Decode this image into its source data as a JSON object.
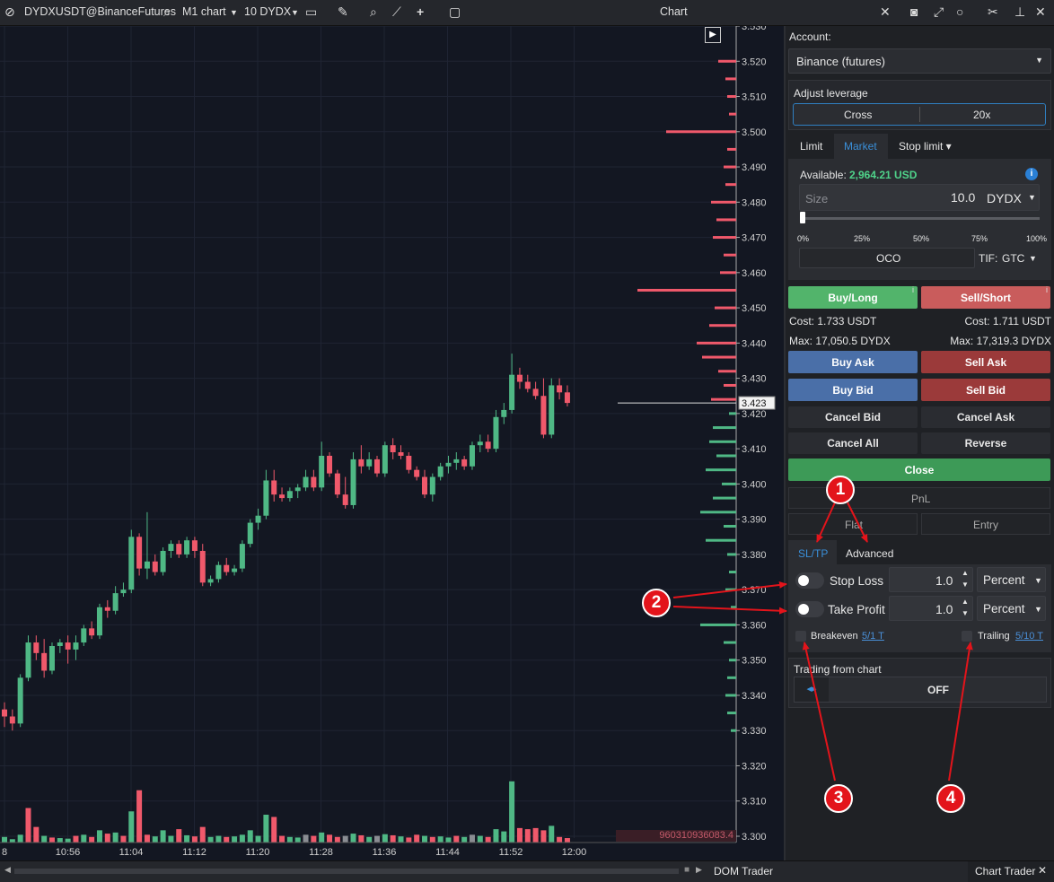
{
  "toolbar": {
    "symbol": "DYDXUSDT@BinanceFutures",
    "timeframe": "M1 chart",
    "volume_label": "10 DYDX",
    "window_title": "Chart"
  },
  "chart": {
    "price_labels": [
      "3.530",
      "3.520",
      "3.510",
      "3.500",
      "3.490",
      "3.480",
      "3.470",
      "3.460",
      "3.450",
      "3.440",
      "3.430",
      "3.420",
      "3.410",
      "3.400",
      "3.390",
      "3.380",
      "3.370",
      "3.360",
      "3.350",
      "3.340",
      "3.330",
      "3.320",
      "3.310",
      "3.300"
    ],
    "current_price": "3.423",
    "time_labels": [
      "8",
      "10:56",
      "11:04",
      "11:12",
      "11:20",
      "11:28",
      "11:36",
      "11:44",
      "11:52",
      "12:00"
    ],
    "volume_total": "960310936083.4",
    "colors": {
      "up": "#4fb885",
      "down": "#f0596b",
      "background": "#131722"
    }
  },
  "chart_data": {
    "type": "candlestick",
    "y_range": [
      3.3,
      3.53
    ],
    "candles_ohlc": [
      [
        3.336,
        3.338,
        3.331,
        3.334
      ],
      [
        3.334,
        3.336,
        3.33,
        3.332
      ],
      [
        3.332,
        3.346,
        3.331,
        3.345
      ],
      [
        3.345,
        3.357,
        3.344,
        3.355
      ],
      [
        3.355,
        3.357,
        3.35,
        3.352
      ],
      [
        3.352,
        3.356,
        3.345,
        3.347
      ],
      [
        3.347,
        3.355,
        3.346,
        3.354
      ],
      [
        3.354,
        3.356,
        3.352,
        3.355
      ],
      [
        3.355,
        3.357,
        3.349,
        3.353
      ],
      [
        3.353,
        3.357,
        3.35,
        3.355
      ],
      [
        3.355,
        3.36,
        3.354,
        3.359
      ],
      [
        3.359,
        3.361,
        3.356,
        3.357
      ],
      [
        3.357,
        3.366,
        3.356,
        3.365
      ],
      [
        3.365,
        3.367,
        3.362,
        3.364
      ],
      [
        3.364,
        3.371,
        3.363,
        3.369
      ],
      [
        3.369,
        3.372,
        3.368,
        3.37
      ],
      [
        3.37,
        3.387,
        3.369,
        3.385
      ],
      [
        3.385,
        3.386,
        3.374,
        3.376
      ],
      [
        3.376,
        3.392,
        3.373,
        3.378
      ],
      [
        3.378,
        3.38,
        3.374,
        3.375
      ],
      [
        3.375,
        3.382,
        3.374,
        3.381
      ],
      [
        3.381,
        3.384,
        3.379,
        3.383
      ],
      [
        3.383,
        3.384,
        3.379,
        3.38
      ],
      [
        3.38,
        3.385,
        3.379,
        3.384
      ],
      [
        3.384,
        3.385,
        3.379,
        3.381
      ],
      [
        3.381,
        3.383,
        3.371,
        3.372
      ],
      [
        3.372,
        3.374,
        3.371,
        3.373
      ],
      [
        3.373,
        3.378,
        3.372,
        3.377
      ],
      [
        3.377,
        3.379,
        3.374,
        3.375
      ],
      [
        3.375,
        3.377,
        3.374,
        3.376
      ],
      [
        3.376,
        3.384,
        3.375,
        3.383
      ],
      [
        3.383,
        3.39,
        3.382,
        3.389
      ],
      [
        3.389,
        3.393,
        3.387,
        3.391
      ],
      [
        3.391,
        3.404,
        3.39,
        3.401
      ],
      [
        3.401,
        3.404,
        3.395,
        3.397
      ],
      [
        3.397,
        3.399,
        3.395,
        3.396
      ],
      [
        3.396,
        3.399,
        3.395,
        3.398
      ],
      [
        3.398,
        3.4,
        3.396,
        3.399
      ],
      [
        3.399,
        3.404,
        3.398,
        3.402
      ],
      [
        3.402,
        3.404,
        3.398,
        3.399
      ],
      [
        3.399,
        3.412,
        3.398,
        3.408
      ],
      [
        3.408,
        3.409,
        3.402,
        3.403
      ],
      [
        3.403,
        3.404,
        3.396,
        3.397
      ],
      [
        3.397,
        3.402,
        3.393,
        3.394
      ],
      [
        3.394,
        3.409,
        3.393,
        3.407
      ],
      [
        3.407,
        3.411,
        3.403,
        3.405
      ],
      [
        3.405,
        3.409,
        3.404,
        3.407
      ],
      [
        3.407,
        3.408,
        3.402,
        3.403
      ],
      [
        3.403,
        3.412,
        3.402,
        3.411
      ],
      [
        3.411,
        3.413,
        3.407,
        3.409
      ],
      [
        3.409,
        3.411,
        3.407,
        3.408
      ],
      [
        3.408,
        3.409,
        3.403,
        3.404
      ],
      [
        3.404,
        3.405,
        3.401,
        3.402
      ],
      [
        3.402,
        3.404,
        3.396,
        3.397
      ],
      [
        3.397,
        3.403,
        3.395,
        3.402
      ],
      [
        3.402,
        3.406,
        3.401,
        3.405
      ],
      [
        3.405,
        3.408,
        3.403,
        3.406
      ],
      [
        3.406,
        3.409,
        3.404,
        3.407
      ],
      [
        3.407,
        3.408,
        3.404,
        3.405
      ],
      [
        3.405,
        3.412,
        3.404,
        3.411
      ],
      [
        3.411,
        3.414,
        3.409,
        3.412
      ],
      [
        3.412,
        3.414,
        3.409,
        3.41
      ],
      [
        3.41,
        3.421,
        3.409,
        3.419
      ],
      [
        3.419,
        3.423,
        3.417,
        3.421
      ],
      [
        3.421,
        3.437,
        3.42,
        3.431
      ],
      [
        3.431,
        3.433,
        3.427,
        3.429
      ],
      [
        3.429,
        3.431,
        3.426,
        3.427
      ],
      [
        3.427,
        3.429,
        3.424,
        3.425
      ],
      [
        3.425,
        3.43,
        3.413,
        3.414
      ],
      [
        3.414,
        3.43,
        3.413,
        3.428
      ],
      [
        3.428,
        3.43,
        3.424,
        3.426
      ],
      [
        3.426,
        3.428,
        3.422,
        3.423
      ]
    ],
    "volumes": [
      [
        10,
        1
      ],
      [
        6,
        1
      ],
      [
        14,
        1
      ],
      [
        62,
        0
      ],
      [
        28,
        0
      ],
      [
        12,
        1
      ],
      [
        9,
        0
      ],
      [
        8,
        1
      ],
      [
        7,
        1
      ],
      [
        12,
        0
      ],
      [
        14,
        1
      ],
      [
        10,
        0
      ],
      [
        22,
        1
      ],
      [
        16,
        0
      ],
      [
        18,
        1
      ],
      [
        12,
        0
      ],
      [
        56,
        1
      ],
      [
        94,
        0
      ],
      [
        14,
        0
      ],
      [
        11,
        1
      ],
      [
        22,
        1
      ],
      [
        12,
        1
      ],
      [
        24,
        0
      ],
      [
        13,
        1
      ],
      [
        11,
        0
      ],
      [
        28,
        0
      ],
      [
        10,
        1
      ],
      [
        12,
        1
      ],
      [
        10,
        0
      ],
      [
        11,
        1
      ],
      [
        14,
        1
      ],
      [
        22,
        1
      ],
      [
        12,
        1
      ],
      [
        50,
        1
      ],
      [
        46,
        0
      ],
      [
        12,
        0
      ],
      [
        10,
        1
      ],
      [
        9,
        1
      ],
      [
        14,
        2
      ],
      [
        12,
        0
      ],
      [
        18,
        1
      ],
      [
        14,
        0
      ],
      [
        10,
        0
      ],
      [
        12,
        2
      ],
      [
        16,
        1
      ],
      [
        13,
        0
      ],
      [
        10,
        1
      ],
      [
        12,
        2
      ],
      [
        15,
        1
      ],
      [
        13,
        0
      ],
      [
        11,
        1
      ],
      [
        9,
        0
      ],
      [
        14,
        0
      ],
      [
        12,
        1
      ],
      [
        10,
        0
      ],
      [
        11,
        1
      ],
      [
        9,
        1
      ],
      [
        12,
        0
      ],
      [
        10,
        1
      ],
      [
        14,
        2
      ],
      [
        12,
        1
      ],
      [
        10,
        0
      ],
      [
        24,
        1
      ],
      [
        20,
        1
      ],
      [
        110,
        1
      ],
      [
        26,
        0
      ],
      [
        24,
        0
      ],
      [
        26,
        0
      ],
      [
        22,
        0
      ],
      [
        30,
        1
      ],
      [
        10,
        0
      ],
      [
        8,
        0
      ]
    ],
    "profile_asks": [
      [
        3.52,
        20
      ],
      [
        3.515,
        12
      ],
      [
        3.51,
        10
      ],
      [
        3.505,
        8
      ],
      [
        3.5,
        78
      ],
      [
        3.495,
        10
      ],
      [
        3.49,
        14
      ],
      [
        3.485,
        12
      ],
      [
        3.48,
        28
      ],
      [
        3.475,
        22
      ],
      [
        3.47,
        26
      ],
      [
        3.465,
        14
      ],
      [
        3.46,
        18
      ],
      [
        3.455,
        110
      ],
      [
        3.45,
        24
      ],
      [
        3.445,
        30
      ],
      [
        3.44,
        44
      ],
      [
        3.436,
        38
      ],
      [
        3.432,
        20
      ],
      [
        3.428,
        14
      ],
      [
        3.424,
        28
      ]
    ],
    "profile_bids": [
      [
        3.42,
        8
      ],
      [
        3.416,
        26
      ],
      [
        3.412,
        30
      ],
      [
        3.408,
        22
      ],
      [
        3.404,
        34
      ],
      [
        3.4,
        16
      ],
      [
        3.396,
        26
      ],
      [
        3.392,
        40
      ],
      [
        3.388,
        14
      ],
      [
        3.384,
        34
      ],
      [
        3.38,
        10
      ],
      [
        3.375,
        8
      ],
      [
        3.37,
        12
      ],
      [
        3.365,
        6
      ],
      [
        3.36,
        40
      ],
      [
        3.355,
        14
      ],
      [
        3.35,
        8
      ],
      [
        3.345,
        10
      ],
      [
        3.34,
        12
      ],
      [
        3.335,
        10
      ],
      [
        3.33,
        6
      ]
    ]
  },
  "panel": {
    "account_label": "Account:",
    "account_value": "Binance (futures)",
    "leverage_label": "Adjust leverage",
    "margin_mode": "Cross",
    "leverage": "20x",
    "order_tabs": [
      "Limit",
      "Market",
      "Stop limit ▾"
    ],
    "available_label": "Available:",
    "available_value": "2,964.21 USD",
    "size_placeholder": "Size",
    "size_value": "10.0",
    "size_unit": "DYDX",
    "slider_marks": [
      "0%",
      "25%",
      "50%",
      "75%",
      "100%"
    ],
    "oco": "OCO",
    "tif_label": "TIF:",
    "tif_value": "GTC",
    "buy_long": "Buy/Long",
    "sell_short": "Sell/Short",
    "buy_cost": "Cost: 1.733 USDT",
    "sell_cost": "Cost: 1.711 USDT",
    "buy_max": "Max: 17,050.5 DYDX",
    "sell_max": "Max: 17,319.3 DYDX",
    "buy_ask": "Buy Ask",
    "sell_ask": "Sell Ask",
    "buy_bid": "Buy Bid",
    "sell_bid": "Sell Bid",
    "cancel_bid": "Cancel Bid",
    "cancel_ask": "Cancel Ask",
    "cancel_all": "Cancel All",
    "reverse": "Reverse",
    "close": "Close",
    "pnl": "PnL",
    "flat": "Flat",
    "entry": "Entry",
    "sltp_tabs": [
      "SL/TP",
      "Advanced"
    ],
    "stop_loss": "Stop Loss",
    "take_profit": "Take Profit",
    "sl_value": "1.0",
    "tp_value": "1.0",
    "sl_unit": "Percent",
    "tp_unit": "Percent",
    "breakeven": "Breakeven",
    "breakeven_link": "5/1 T",
    "trailing": "Trailing",
    "trailing_link": "5/10 T",
    "trading_from_chart": "Trading from chart",
    "trading_state": "OFF"
  },
  "annotations": [
    "1",
    "2",
    "3",
    "4"
  ],
  "bottom_tabs": [
    "DOM Trader",
    "Chart Trader"
  ]
}
